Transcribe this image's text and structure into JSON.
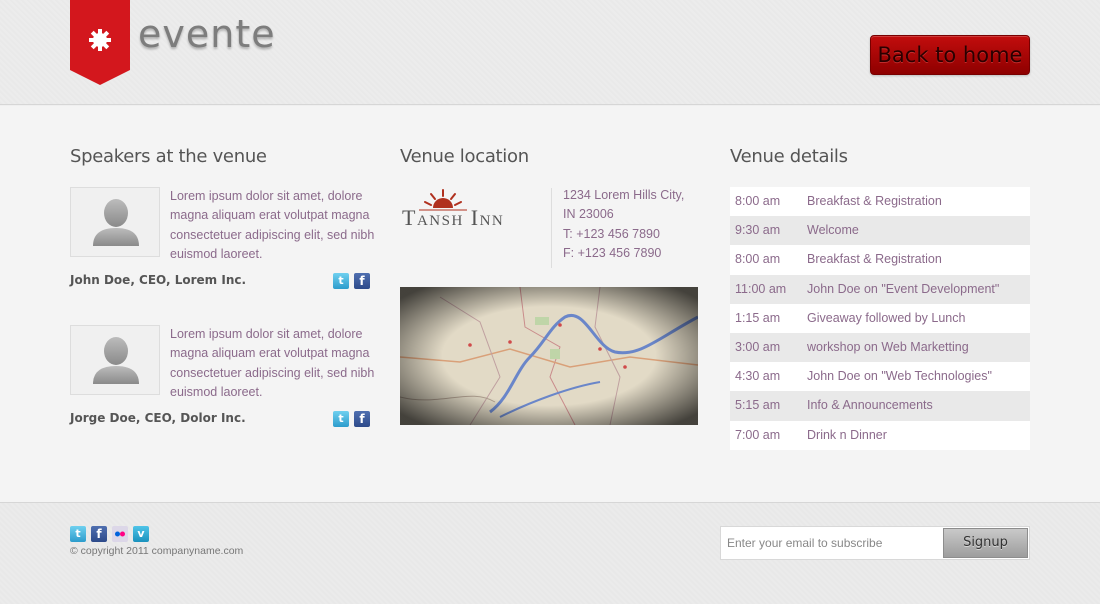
{
  "header": {
    "logo_text": "evente",
    "back_home_label": "Back to home"
  },
  "speakers": {
    "title": "Speakers at the venue",
    "items": [
      {
        "bio": "Lorem ipsum dolor sit amet, dolore magna aliquam erat volutpat magna consectetuer adipiscing elit, sed nibh euismod laoreet.",
        "name": "John Doe, CEO, Lorem Inc."
      },
      {
        "bio": "Lorem ipsum dolor sit amet, dolore magna aliquam erat volutpat magna consectetuer adipiscing elit, sed nibh euismod laoreet.",
        "name": "Jorge Doe, CEO, Dolor Inc."
      }
    ]
  },
  "location": {
    "title": "Venue location",
    "venue_name": "Tansh Inn",
    "address_line1": "1234 Lorem Hills City,",
    "address_line2": "IN 23006",
    "phone": "T: +123 456 7890",
    "fax": "F: +123 456 7890"
  },
  "details": {
    "title": "Venue details",
    "schedule": [
      {
        "time": "8:00 am",
        "event": "Breakfast & Registration"
      },
      {
        "time": "9:30 am",
        "event": "Welcome"
      },
      {
        "time": "8:00 am",
        "event": "Breakfast & Registration"
      },
      {
        "time": "11:00 am",
        "event": "John Doe on \"Event Development\""
      },
      {
        "time": "1:15 am",
        "event": "Giveaway followed by Lunch"
      },
      {
        "time": "3:00 am",
        "event": "workshop on Web Marketting"
      },
      {
        "time": "4:30 am",
        "event": "John Doe on \"Web Technologies\""
      },
      {
        "time": "5:15 am",
        "event": "Info & Announcements"
      },
      {
        "time": "7:00 am",
        "event": "Drink n Dinner"
      }
    ]
  },
  "footer": {
    "copyright": "© copyright 2011 companyname.com",
    "email_placeholder": "Enter your email to subscribe",
    "signup_label": "Signup"
  },
  "colors": {
    "accent_red": "#c20d0d",
    "text_purple": "#8b6a8b"
  },
  "icons": [
    "twitter-icon",
    "facebook-icon",
    "flickr-icon",
    "vimeo-icon",
    "star-logo-icon"
  ]
}
